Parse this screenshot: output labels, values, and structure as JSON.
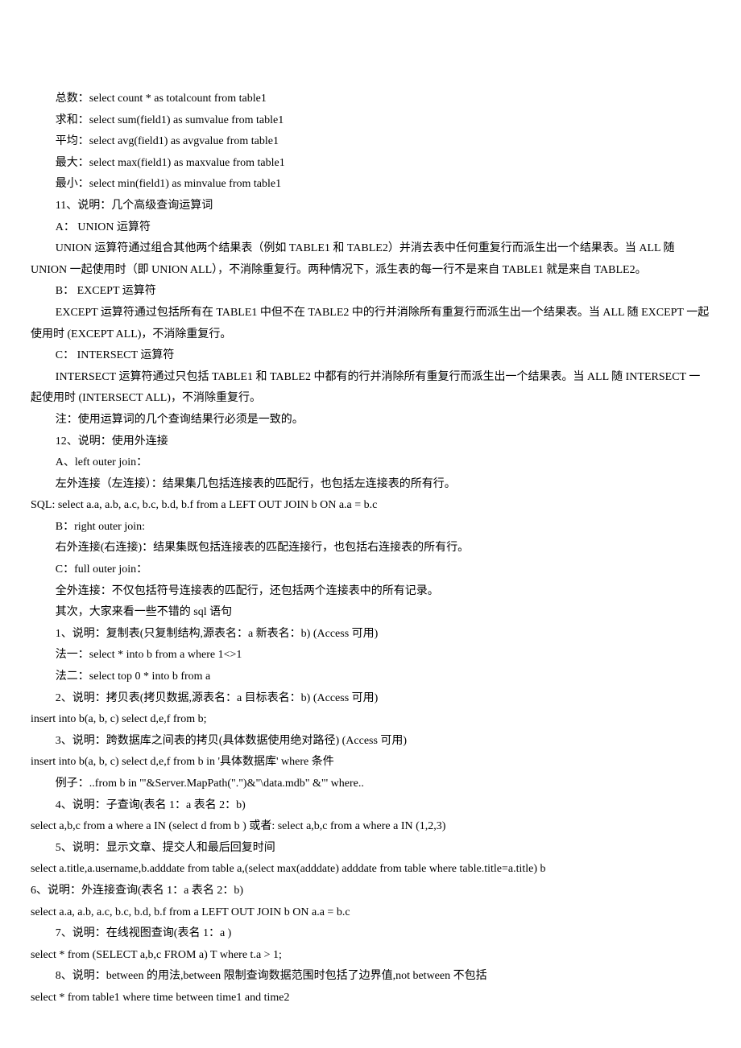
{
  "lines": [
    {
      "indent": true,
      "text": "总数：select count * as totalcount from table1"
    },
    {
      "indent": true,
      "text": "求和：select sum(field1) as sumvalue from table1"
    },
    {
      "indent": true,
      "text": "平均：select avg(field1) as avgvalue from table1"
    },
    {
      "indent": true,
      "text": "最大：select max(field1) as maxvalue from table1"
    },
    {
      "indent": true,
      "text": "最小：select min(field1) as minvalue from table1"
    },
    {
      "indent": true,
      "text": "11、说明：几个高级查询运算词"
    },
    {
      "indent": true,
      "text": "A： UNION 运算符"
    },
    {
      "indent": true,
      "text": "UNION 运算符通过组合其他两个结果表（例如 TABLE1 和 TABLE2）并消去表中任何重复行而派生出一个结果表。当 ALL 随 UNION 一起使用时（即 UNION ALL），不消除重复行。两种情况下，派生表的每一行不是来自 TABLE1 就是来自 TABLE2。"
    },
    {
      "indent": true,
      "text": "B： EXCEPT 运算符"
    },
    {
      "indent": true,
      "text": "EXCEPT 运算符通过包括所有在 TABLE1 中但不在 TABLE2 中的行并消除所有重复行而派生出一个结果表。当 ALL 随 EXCEPT 一起使用时 (EXCEPT ALL)，不消除重复行。"
    },
    {
      "indent": true,
      "text": "C： INTERSECT 运算符"
    },
    {
      "indent": true,
      "text": "INTERSECT 运算符通过只包括 TABLE1 和 TABLE2 中都有的行并消除所有重复行而派生出一个结果表。当 ALL 随 INTERSECT 一起使用时 (INTERSECT ALL)，不消除重复行。"
    },
    {
      "indent": true,
      "text": "注：使用运算词的几个查询结果行必须是一致的。"
    },
    {
      "indent": true,
      "text": "12、说明：使用外连接"
    },
    {
      "indent": true,
      "text": "A、left outer join："
    },
    {
      "indent": true,
      "text": "左外连接（左连接）：结果集几包括连接表的匹配行，也包括左连接表的所有行。"
    },
    {
      "indent": false,
      "text": "SQL: select a.a, a.b, a.c, b.c, b.d, b.f from a LEFT OUT JOIN b ON a.a = b.c"
    },
    {
      "indent": true,
      "text": "B：right outer join:"
    },
    {
      "indent": true,
      "text": "右外连接(右连接)：结果集既包括连接表的匹配连接行，也包括右连接表的所有行。"
    },
    {
      "indent": true,
      "text": "C：full outer join："
    },
    {
      "indent": true,
      "text": "全外连接：不仅包括符号连接表的匹配行，还包括两个连接表中的所有记录。"
    },
    {
      "indent": true,
      "text": "其次，大家来看一些不错的 sql 语句"
    },
    {
      "indent": true,
      "text": "1、说明：复制表(只复制结构,源表名：a 新表名：b) (Access 可用)"
    },
    {
      "indent": true,
      "text": "法一：select * into b from a where 1<>1"
    },
    {
      "indent": true,
      "text": "法二：select top 0 * into b from a"
    },
    {
      "indent": true,
      "text": "2、说明：拷贝表(拷贝数据,源表名：a 目标表名：b) (Access 可用)"
    },
    {
      "indent": false,
      "text": "insert into b(a, b, c) select d,e,f from b;"
    },
    {
      "indent": true,
      "text": "3、说明：跨数据库之间表的拷贝(具体数据使用绝对路径) (Access 可用)"
    },
    {
      "indent": false,
      "text": "insert into b(a, b, c) select d,e,f from b in '具体数据库' where 条件"
    },
    {
      "indent": true,
      "text": "例子：..from b in '\"&Server.MapPath(\".\")&\"\\data.mdb\" &\"' where.."
    },
    {
      "indent": true,
      "text": "4、说明：子查询(表名 1：a 表名 2：b)"
    },
    {
      "indent": false,
      "text": "select a,b,c from a where a IN (select d from b ) 或者: select a,b,c from a where a IN (1,2,3)"
    },
    {
      "indent": true,
      "text": "5、说明：显示文章、提交人和最后回复时间"
    },
    {
      "indent": false,
      "text": "select a.title,a.username,b.adddate from table a,(select max(adddate) adddate from table where table.title=a.title) b"
    },
    {
      "indent": false,
      "text": "6、说明：外连接查询(表名 1：a 表名 2：b)"
    },
    {
      "indent": false,
      "text": "select a.a, a.b, a.c, b.c, b.d, b.f from a LEFT OUT JOIN b ON a.a = b.c"
    },
    {
      "indent": true,
      "text": "7、说明：在线视图查询(表名 1：a )"
    },
    {
      "indent": false,
      "text": "select * from (SELECT a,b,c FROM a) T where t.a > 1;"
    },
    {
      "indent": true,
      "text": "8、说明：between 的用法,between 限制查询数据范围时包括了边界值,not between 不包括"
    },
    {
      "indent": false,
      "text": "select * from table1 where time between time1 and time2"
    }
  ]
}
